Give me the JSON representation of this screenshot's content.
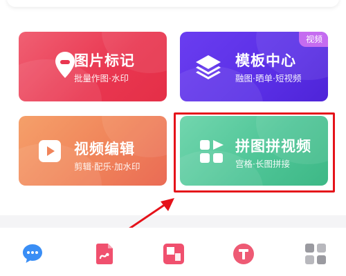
{
  "cards": {
    "photo_mark": {
      "title": "图片标记",
      "subtitle": "批量作图·水印",
      "icon": "location-pin-icon"
    },
    "template_center": {
      "title": "模板中心",
      "subtitle": "融图·晒单·短视频",
      "badge": "视频",
      "icon": "layers-icon"
    },
    "video_edit": {
      "title": "视频编辑",
      "subtitle": "剪辑·配乐·加水印",
      "icon": "play-icon"
    },
    "collage_video": {
      "title": "拼图拼视频",
      "subtitle": "宫格·长图拼接",
      "icon": "grid-icon"
    }
  },
  "bottom_nav": {
    "icons": [
      "chat-bubble-icon",
      "document-swirl-icon",
      "collage-squares-icon",
      "t-text-icon",
      "apps-grid-icon"
    ]
  },
  "colors": {
    "photo_mark": "#e93650",
    "template_center": "#5a2fe6",
    "video_edit": "#f0845a",
    "collage_video": "#4fc597",
    "annotation_red": "#e5121a",
    "badge": "#c56cf0"
  }
}
